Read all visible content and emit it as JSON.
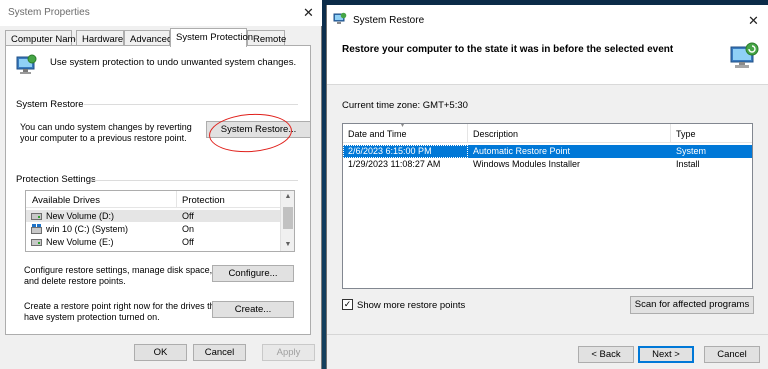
{
  "left_window": {
    "title": "System Properties",
    "close_glyph": "✕",
    "tabs": [
      "Computer Name",
      "Hardware",
      "Advanced",
      "System Protection",
      "Remote"
    ],
    "active_tab": "System Protection",
    "intro_text": "Use system protection to undo unwanted system changes.",
    "system_restore": {
      "group_label": "System Restore",
      "description_line1": "You can undo system changes by reverting",
      "description_line2": "your computer to a previous restore point.",
      "button_label": "System Restore..."
    },
    "protection_settings": {
      "group_label": "Protection Settings",
      "columns": [
        "Available Drives",
        "Protection"
      ],
      "drives": [
        {
          "name": "New Volume (D:)",
          "protection": "Off",
          "icon": "drive-icon"
        },
        {
          "name": "win 10 (C:) (System)",
          "protection": "On",
          "icon": "system-drive-icon"
        },
        {
          "name": "New Volume (E:)",
          "protection": "Off",
          "icon": "drive-icon"
        }
      ],
      "configure_text_line1": "Configure restore settings, manage disk space,",
      "configure_text_line2": "and delete restore points.",
      "configure_button": "Configure...",
      "create_text_line1": "Create a restore point right now for the drives that",
      "create_text_line2": "have system protection turned on.",
      "create_button": "Create..."
    },
    "footer": {
      "ok": "OK",
      "cancel": "Cancel",
      "apply": "Apply"
    }
  },
  "right_window": {
    "title": "System Restore",
    "close_glyph": "✕",
    "heading": "Restore your computer to the state it was in before the selected event",
    "timezone": "Current time zone: GMT+5:30",
    "columns": [
      "Date and Time",
      "Description",
      "Type"
    ],
    "rows": [
      {
        "date": "2/6/2023 6:15:00 PM",
        "description": "Automatic Restore Point",
        "type": "System",
        "selected": true
      },
      {
        "date": "1/29/2023 11:08:27 AM",
        "description": "Windows Modules Installer",
        "type": "Install",
        "selected": false
      }
    ],
    "show_more_label": "Show more restore points",
    "show_more_checked": true,
    "scan_button": "Scan for affected programs",
    "back_button": "< Back",
    "next_button": "Next >",
    "cancel_button": "Cancel"
  },
  "colors": {
    "selection": "#0078d7",
    "annotation_circle": "#e0201b",
    "desktop": "#0e3a5e"
  }
}
